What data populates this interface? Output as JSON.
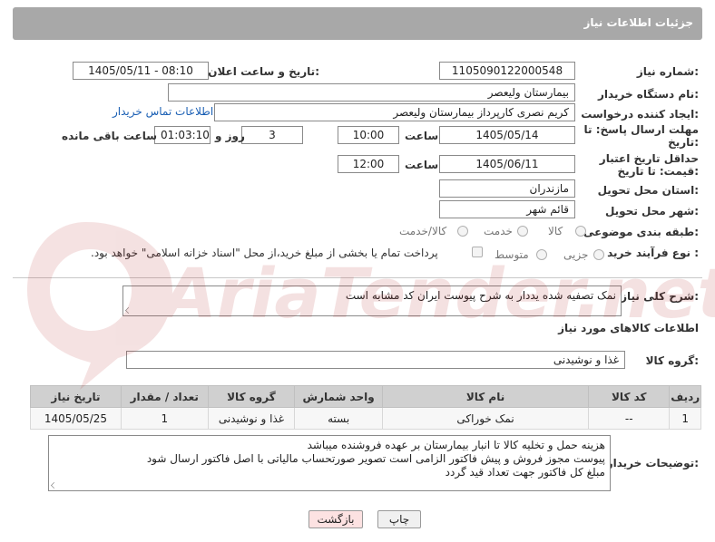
{
  "header": {
    "title": "جزئیات اطلاعات نیاز"
  },
  "labels": {
    "need_number": "شماره نیاز:",
    "announce_datetime": "تاریخ و ساعت اعلان عمومی:",
    "buyer_org": "نام دستگاه خریدار:",
    "requester": "ایجاد کننده درخواست:",
    "buyer_contact": "اطلاعات تماس خریدار",
    "reply_deadline": "مهلت ارسال پاسخ: تا تاریخ:",
    "time": "ساعت",
    "day_and": "روز و",
    "remaining": "ساعت باقی مانده",
    "price_validity": "حداقل تاریخ اعتبار قیمت: تا تاریخ:",
    "time2": "ساعت",
    "delivery_province": "استان محل تحویل:",
    "delivery_city": "شهر محل تحویل:",
    "category": "طبقه بندی موضوعی:",
    "purchase_type": "نوع فرآیند خرید :",
    "description": "شرح کلی نیاز:",
    "goods_info": "اطلاعات کالاهای مورد نیاز",
    "goods_group": "گروه کالا:",
    "buyer_notes": "توضیحات خریدار:"
  },
  "values": {
    "need_number": "1105090122000548",
    "announce_datetime": "1405/05/11 - 08:10",
    "buyer_org": "بیمارستان ولیعصر",
    "requester": "کریم نصری کارپرداز بیمارستان ولیعصر",
    "reply_date": "1405/05/14",
    "reply_time": "10:00",
    "days": "3",
    "remaining_time": "01:03:10",
    "validity_date": "1405/06/11",
    "validity_time": "12:00",
    "province": "مازندران",
    "city": "قائم شهر",
    "description": "نمک تصفیه شده یددار به شرح پیوست   ایران کد مشابه است",
    "goods_group": "غذا و نوشیدنی",
    "buyer_notes_1": "هزینه حمل و تخلیه کالا تا انبار بیمارستان بر عهده فروشنده میباشد",
    "buyer_notes_2": "پیوست مجوز فروش و پیش فاکتور الزامی است  تصویر صورتحساب مالیاتی با اصل فاکتور ارسال شود",
    "buyer_notes_3": "مبلغ کل فاکتور جهت تعداد قید گردد"
  },
  "category_options": {
    "goods": "کالا",
    "service": "خدمت",
    "goods_service": "کالا/خدمت"
  },
  "purchase_options": {
    "minor": "جزیی",
    "medium": "متوسط",
    "payment_note": "پرداخت تمام یا بخشی از مبلغ خرید،از محل \"اسناد خزانه اسلامی\" خواهد بود."
  },
  "table": {
    "headers": [
      "ردیف",
      "کد کالا",
      "نام کالا",
      "واحد شمارش",
      "گروه کالا",
      "تعداد / مقدار",
      "تاریخ نیاز"
    ],
    "rows": [
      [
        "1",
        "--",
        "نمک خوراکی",
        "بسته",
        "غذا و نوشیدنی",
        "1",
        "1405/05/25"
      ]
    ]
  },
  "buttons": {
    "print": "چاپ",
    "back": "بازگشت"
  },
  "watermark": {
    "text": "AriaTender.net"
  }
}
